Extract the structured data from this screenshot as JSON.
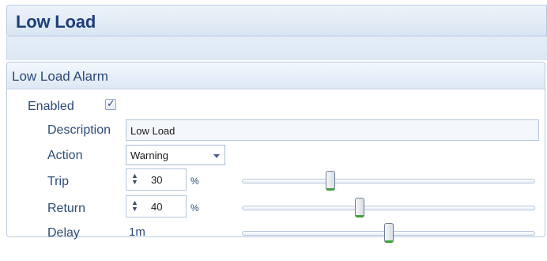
{
  "page": {
    "title": "Low Load"
  },
  "group": {
    "title": "Low Load Alarm",
    "enabled": {
      "label": "Enabled",
      "checked": true,
      "checkmark": "✓"
    },
    "description": {
      "label": "Description",
      "value": "Low Load"
    },
    "action": {
      "label": "Action",
      "value": "Warning"
    },
    "trip": {
      "label": "Trip",
      "value": "30",
      "unit": "%",
      "slider_fraction": 0.3
    },
    "return": {
      "label": "Return",
      "value": "40",
      "unit": "%",
      "slider_fraction": 0.4
    },
    "delay": {
      "label": "Delay",
      "value": "1m",
      "slider_fraction": 0.5
    }
  },
  "icons": {
    "spinner": "up-down-arrows-icon",
    "dropdown": "chevron-down-icon",
    "check": "checkmark-icon"
  },
  "colors": {
    "title": "#1d3f78",
    "label": "#2c4b76",
    "header_bg": "#dce7f4",
    "slider_accent": "#3e9f3e"
  }
}
